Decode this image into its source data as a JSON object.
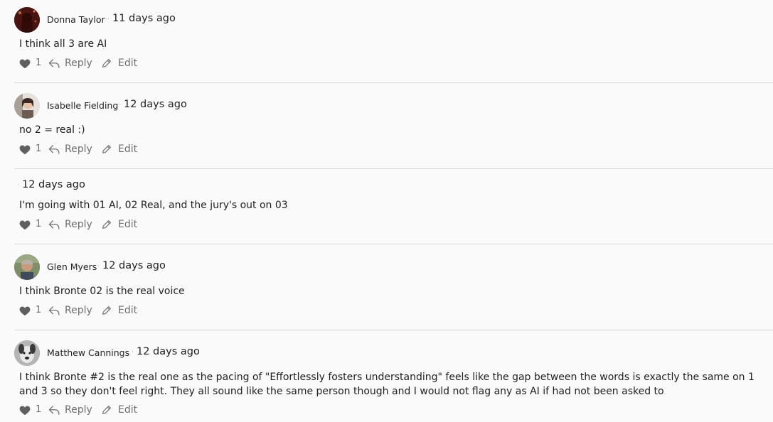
{
  "actions": {
    "reply_label": "Reply",
    "edit_label": "Edit",
    "separator": "·"
  },
  "comments": [
    {
      "author": "Donna Taylor",
      "time": "11 days ago",
      "text": "I think all 3 are AI",
      "likes": "1",
      "avatar": "avatar-dark-red"
    },
    {
      "author": "Isabelle Fielding",
      "time": "12 days ago",
      "text": "no 2 = real :)",
      "likes": "1",
      "avatar": "avatar-photo-woman"
    },
    {
      "author": "",
      "time": "12 days ago",
      "text": "I'm going with 01 AI, 02 Real, and the jury's out on 03",
      "likes": "1",
      "avatar": ""
    },
    {
      "author": "Glen Myers",
      "time": "12 days ago",
      "text": "I think Bronte 02 is the real voice",
      "likes": "1",
      "avatar": "avatar-photo-man"
    },
    {
      "author": "Matthew Cannings",
      "time": "12 days ago",
      "text": "I think Bronte #2 is the real one as the pacing of \"Effortlessly fosters understanding\" feels like the gap between the words is exactly the same on 1 and 3 so they don't feel right. They all sound like the same person though and I would not flag any as AI if had not been asked to",
      "likes": "1",
      "avatar": "avatar-photo-dog"
    }
  ],
  "colors": {
    "background": "#fafafa",
    "divider": "#d9d9d9",
    "action_text": "#6f6f6f",
    "heart": "#5f5f5f"
  }
}
